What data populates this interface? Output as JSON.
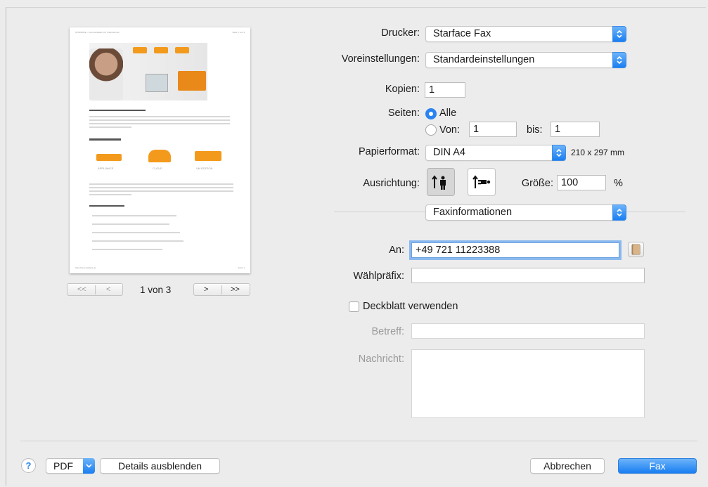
{
  "preview": {
    "page_indicator": "1 von 3",
    "nav": {
      "first": "<<",
      "prev": "<",
      "next": ">",
      "last": ">>"
    },
    "page": {
      "header_left": "STARFACE – Kommunikation für Unternehmen",
      "header_right": "Seite 1 von 3",
      "heading": "Die IT-Telefonanlage für Ihr Unternehmen",
      "subheading": "Für jede Betriebsart:",
      "labels": [
        "APPLIANCE",
        "CLOUD",
        "VM EDITION"
      ],
      "list_heading": "Gründe für STARFACE:",
      "footer_left": "http://www.starface.de",
      "footer_right": "Seite 1"
    }
  },
  "drucker": {
    "label": "Drucker:",
    "value": "Starface Fax"
  },
  "voreinstellungen": {
    "label": "Voreinstellungen:",
    "value": "Standardeinstellungen"
  },
  "kopien": {
    "label": "Kopien:",
    "value": "1"
  },
  "seiten": {
    "label": "Seiten:",
    "alle": "Alle",
    "von_label": "Von:",
    "von_value": "1",
    "bis_label": "bis:",
    "bis_value": "1"
  },
  "papierformat": {
    "label": "Papierformat:",
    "value": "DIN A4",
    "size": "210 x 297 mm"
  },
  "ausrichtung": {
    "label": "Ausrichtung:"
  },
  "groesse": {
    "label": "Größe:",
    "value": "100",
    "unit": "%"
  },
  "section_popup": {
    "value": "Faxinformationen"
  },
  "fax": {
    "an_label": "An:",
    "an_value": "+49 721 11223388",
    "waehlpraefix_label": "Wählpräfix:",
    "waehlpraefix_value": "",
    "deckblatt_label": "Deckblatt verwenden",
    "betreff_label": "Betreff:",
    "nachricht_label": "Nachricht:"
  },
  "footer": {
    "help": "?",
    "pdf": "PDF",
    "details": "Details ausblenden",
    "cancel": "Abbrechen",
    "fax": "Fax"
  },
  "colors": {
    "accent": "#1a7ef1",
    "orange": "#f39a1d"
  }
}
